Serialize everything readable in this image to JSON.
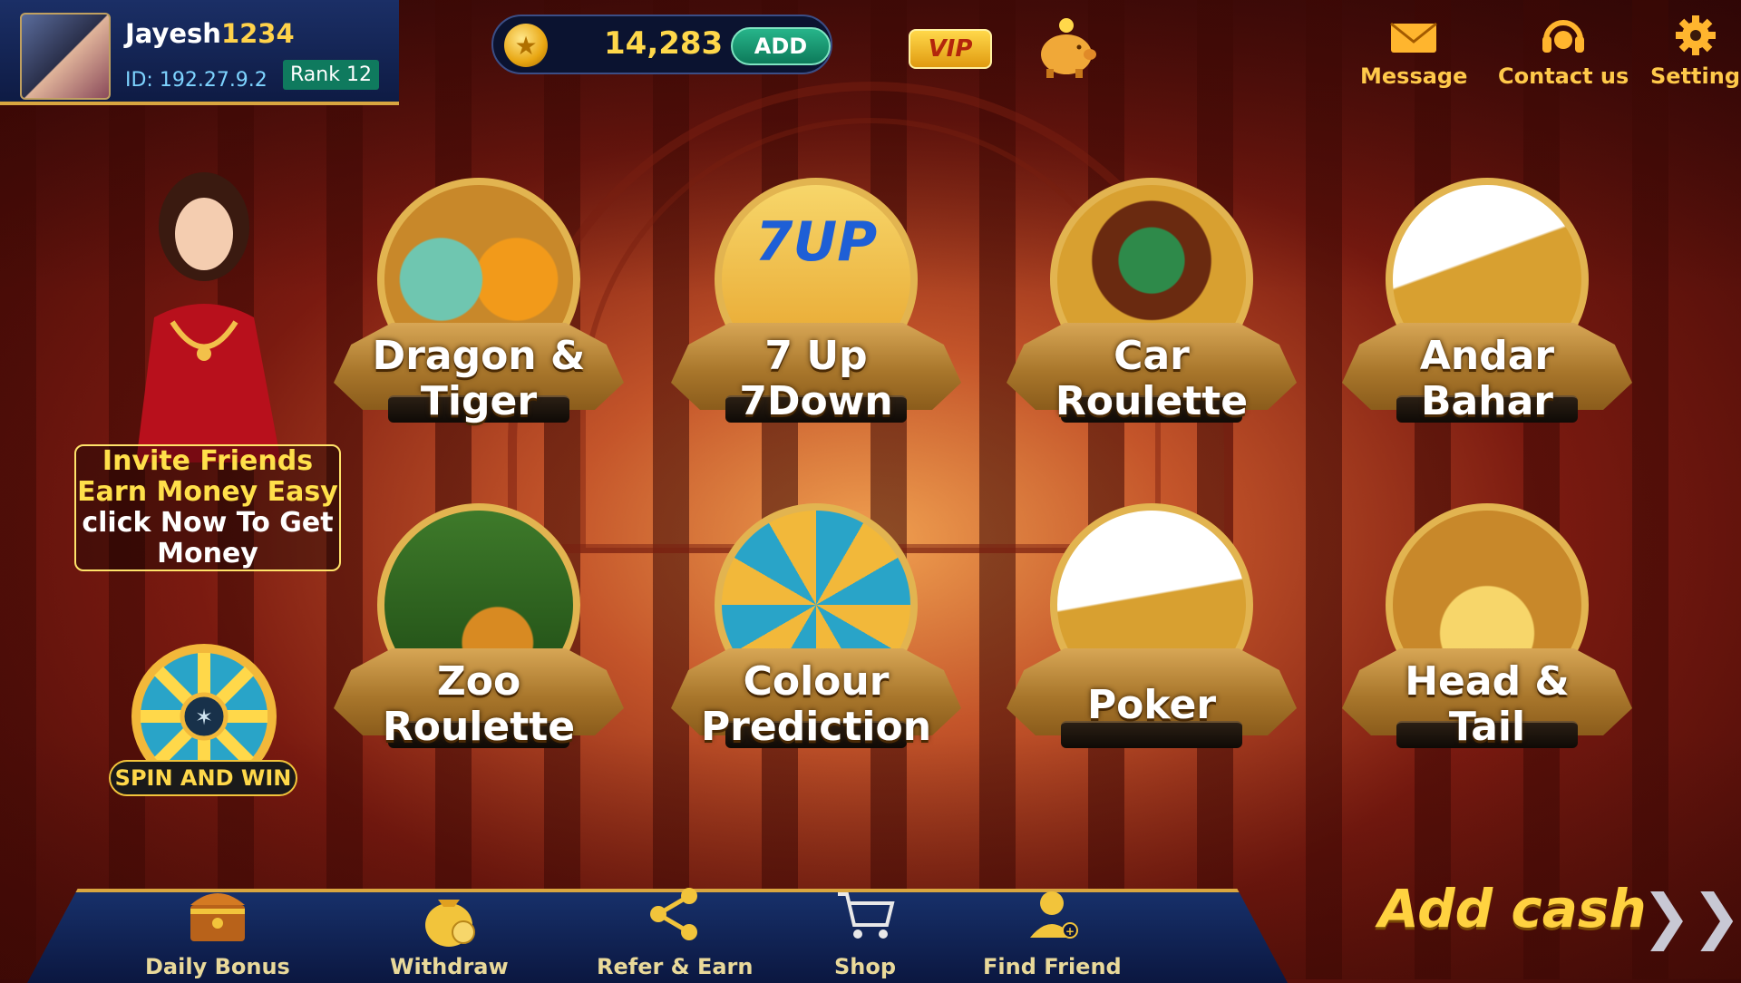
{
  "profile": {
    "name_prefix": "Jayesh",
    "name_number": "1234",
    "id_text": "ID: 192.27.9.2",
    "rank": "Rank 12"
  },
  "wallet": {
    "coin_amount": "14,283",
    "add_label": "ADD",
    "vip_label": "VIP"
  },
  "top_actions": [
    {
      "label": "Message",
      "icon": "envelope-icon"
    },
    {
      "label": "Contact us",
      "icon": "headset-icon"
    },
    {
      "label": "Setting",
      "icon": "gear-icon"
    }
  ],
  "promo": {
    "line1": "Invite Friends",
    "line2": "Earn Money Easy",
    "line3": "click Now To Get",
    "line4": "Money",
    "spin_label": "SPIN AND WIN"
  },
  "games": [
    {
      "line1": "Dragon &",
      "line2": "Tiger"
    },
    {
      "line1": "7 Up",
      "line2": "7Down",
      "art_text": "7UP"
    },
    {
      "line1": "Car",
      "line2": "Roulette"
    },
    {
      "line1": "Andar",
      "line2": "Bahar"
    },
    {
      "line1": "Zoo",
      "line2": "Roulette"
    },
    {
      "line1": "Colour",
      "line2": "Prediction"
    },
    {
      "line1": "Poker"
    },
    {
      "line1": "Head &",
      "line2": "Tail"
    }
  ],
  "bottom_nav": [
    {
      "label": "Daily Bonus",
      "icon": "treasure-chest-icon"
    },
    {
      "label": "Withdraw",
      "icon": "money-bag-icon"
    },
    {
      "label": "Refer & Earn",
      "icon": "share-icon"
    },
    {
      "label": "Shop",
      "icon": "cart-icon"
    },
    {
      "label": "Find Friend",
      "icon": "add-user-icon"
    }
  ],
  "add_cash_label": "Add cash",
  "colors": {
    "gold": "#ffd240",
    "navy": "#17306a",
    "green": "#0f7a5e"
  }
}
